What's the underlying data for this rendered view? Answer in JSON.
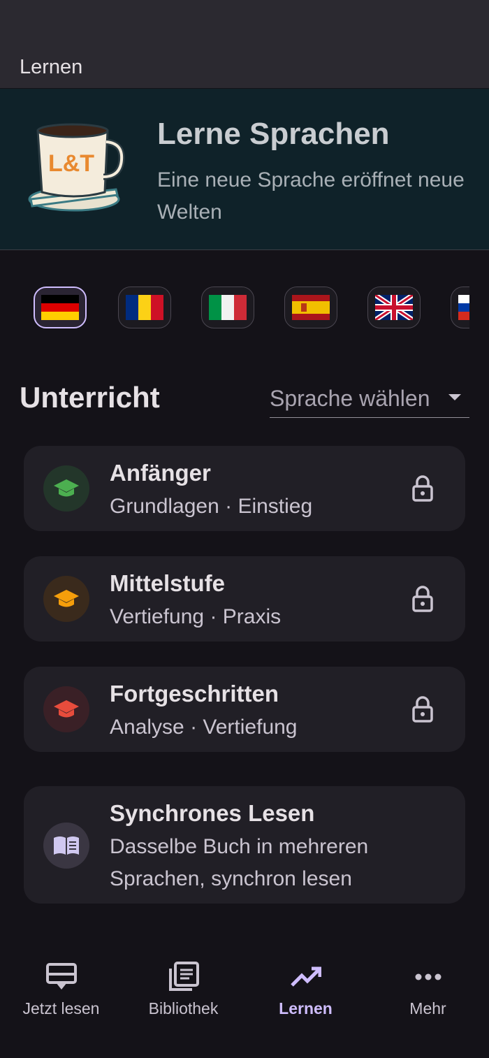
{
  "topbar": {
    "title": "Lernen"
  },
  "hero": {
    "logo_text": "L&T",
    "title": "Lerne Sprachen",
    "subtitle": "Eine neue Sprache eröffnet neue Welten"
  },
  "flags": [
    "de",
    "ro",
    "it",
    "es",
    "gb",
    "ru"
  ],
  "lessons": {
    "title": "Unterricht",
    "select_placeholder": "Sprache wählen"
  },
  "cards": [
    {
      "title": "Anfänger",
      "subtitle": "Grundlagen · Einstieg",
      "icon": "graduation-cap-icon",
      "color": "#4caf50",
      "bg": "#23362a",
      "locked": true
    },
    {
      "title": "Mittelstufe",
      "subtitle": "Vertiefung · Praxis",
      "icon": "graduation-cap-icon",
      "color": "#f59e0b",
      "bg": "#3a2a1c",
      "locked": true
    },
    {
      "title": "Fortgeschritten",
      "subtitle": "Analyse · Vertiefung",
      "icon": "graduation-cap-icon",
      "color": "#e74c3c",
      "bg": "#3a2026",
      "locked": true
    },
    {
      "title": "Synchrones Lesen",
      "subtitle": "Dasselbe Buch in mehreren Sprachen, synchron lesen",
      "icon": "open-book-icon",
      "color": "#d0c8f0",
      "bg": "#3a3642"
    }
  ],
  "nav": [
    {
      "label": "Jetzt lesen",
      "icon": "reader-icon"
    },
    {
      "label": "Bibliothek",
      "icon": "library-icon"
    },
    {
      "label": "Lernen",
      "icon": "trending-up-icon",
      "active": true
    },
    {
      "label": "Mehr",
      "icon": "more-horizontal-icon"
    }
  ],
  "colors": {
    "accent": "#cfbdfe",
    "background": "#141218",
    "card": "#211f26",
    "hero": "#0f2229"
  }
}
